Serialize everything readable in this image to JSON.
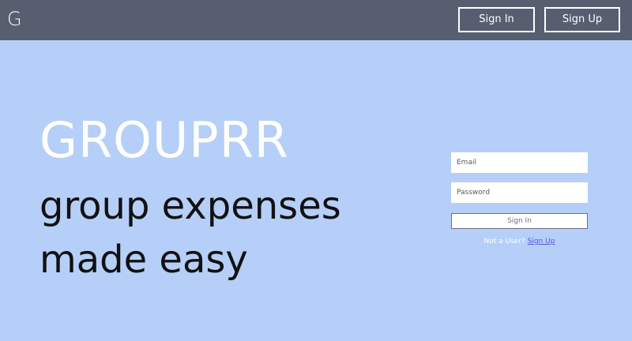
{
  "navbar": {
    "logo": "G",
    "sign_in_label": "Sign In",
    "sign_up_label": "Sign Up"
  },
  "hero": {
    "title": "GROUPRR",
    "tagline_line1": "group expenses",
    "tagline_line2": "made easy"
  },
  "login_form": {
    "email_placeholder": "Email",
    "password_placeholder": "Password",
    "submit_label": "Sign In",
    "prompt_text": "Not a User?",
    "signup_link_label": "Sign Up"
  },
  "colors": {
    "background": "#b5cff8",
    "navbar": "#575e6f",
    "link": "#5b55d8"
  }
}
